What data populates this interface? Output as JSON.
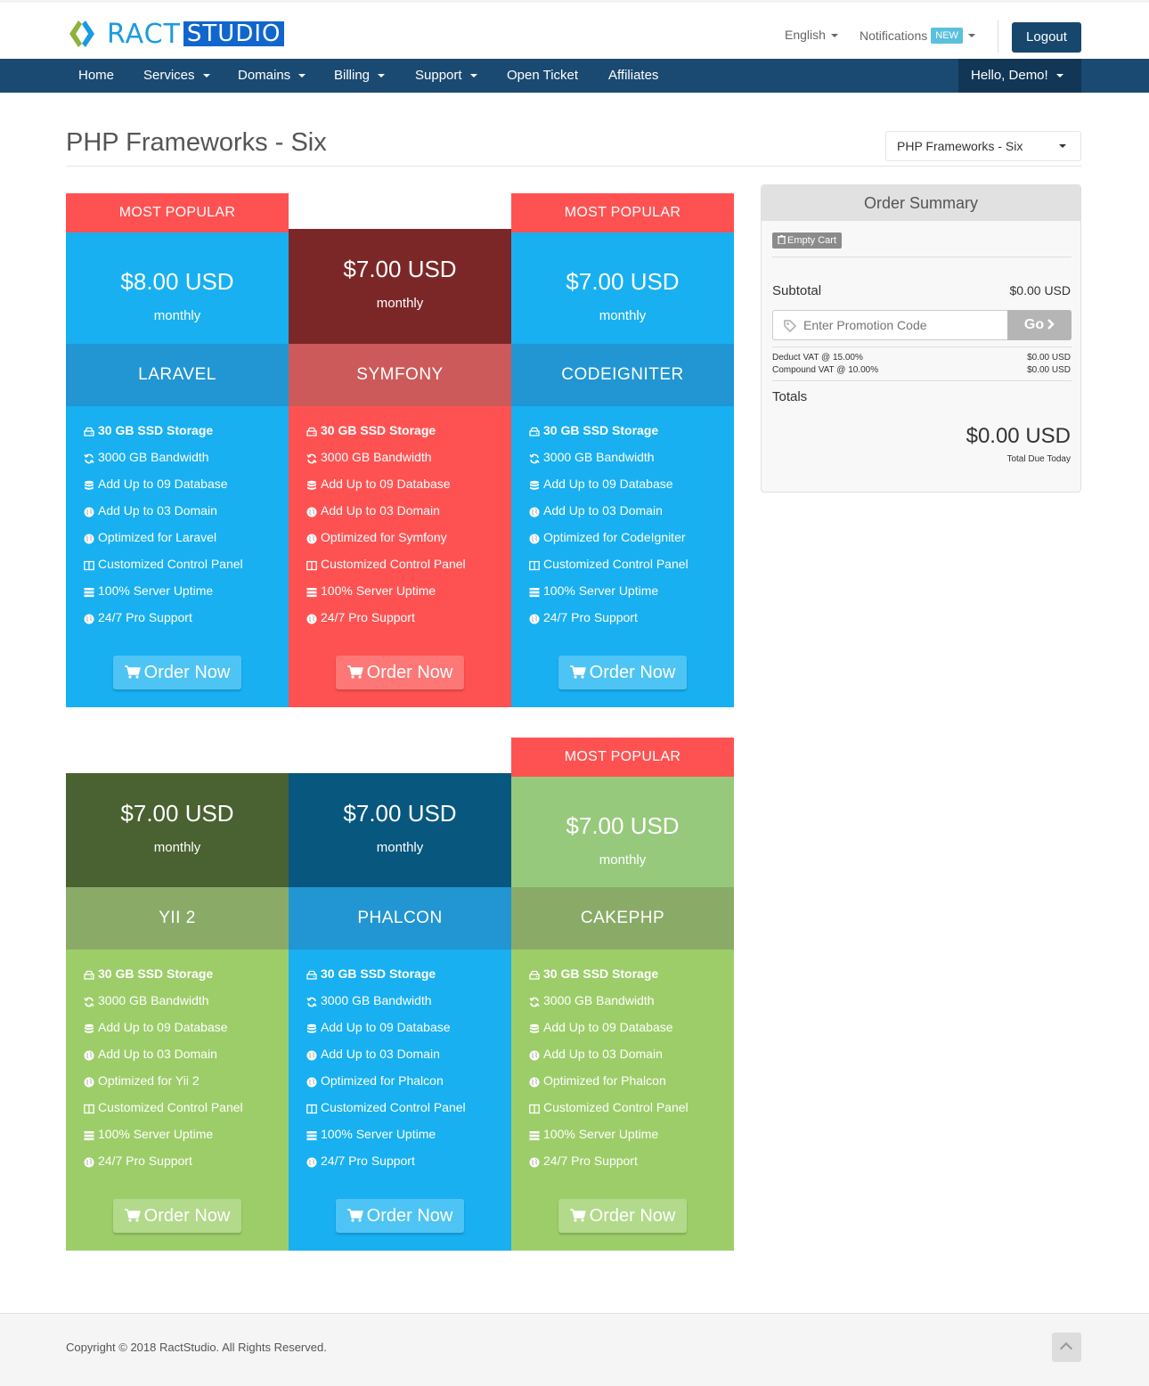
{
  "header": {
    "logo_text1": "RACT",
    "logo_text2": "STUDIO",
    "language": "English",
    "notifications": "Notifications",
    "notifications_badge": "NEW",
    "logout": "Logout"
  },
  "nav": {
    "items": [
      {
        "label": "Home",
        "dropdown": false
      },
      {
        "label": "Services",
        "dropdown": true
      },
      {
        "label": "Domains",
        "dropdown": true
      },
      {
        "label": "Billing",
        "dropdown": true
      },
      {
        "label": "Support",
        "dropdown": true
      },
      {
        "label": "Open Ticket",
        "dropdown": false
      },
      {
        "label": "Affiliates",
        "dropdown": false
      }
    ],
    "user": "Hello, Demo!"
  },
  "page": {
    "title": "PHP Frameworks - Six",
    "category_select": "PHP Frameworks - Six"
  },
  "cards": [
    {
      "name": "LARAVEL",
      "price": "$8.00 USD",
      "cycle": "monthly",
      "popular": "MOST POPULAR",
      "features": [
        "30 GB SSD Storage",
        "3000 GB Bandwidth",
        "Add Up to 09 Database",
        "Add Up to 03 Domain",
        "Optimized for Laravel",
        "Customized Control Panel",
        "100% Server Uptime",
        "24/7 Pro Support"
      ],
      "order": "Order Now"
    },
    {
      "name": "SYMFONY",
      "price": "$7.00 USD",
      "cycle": "monthly",
      "popular": "",
      "features": [
        "30 GB SSD Storage",
        "3000 GB Bandwidth",
        "Add Up to 09 Database",
        "Add Up to 03 Domain",
        "Optimized for Symfony",
        "Customized Control Panel",
        "100% Server Uptime",
        "24/7 Pro Support"
      ],
      "order": "Order Now"
    },
    {
      "name": "CODEIGNITER",
      "price": "$7.00 USD",
      "cycle": "monthly",
      "popular": "MOST POPULAR",
      "features": [
        "30 GB SSD Storage",
        "3000 GB Bandwidth",
        "Add Up to 09 Database",
        "Add Up to 03 Domain",
        "Optimized for CodeIgniter",
        "Customized Control Panel",
        "100% Server Uptime",
        "24/7 Pro Support"
      ],
      "order": "Order Now"
    },
    {
      "name": "YII 2",
      "price": "$7.00 USD",
      "cycle": "monthly",
      "popular": "",
      "features": [
        "30 GB SSD Storage",
        "3000 GB Bandwidth",
        "Add Up to 09 Database",
        "Add Up to 03 Domain",
        "Optimized for Yii 2",
        "Customized Control Panel",
        "100% Server Uptime",
        "24/7 Pro Support"
      ],
      "order": "Order Now"
    },
    {
      "name": "PHALCON",
      "price": "$7.00 USD",
      "cycle": "monthly",
      "popular": "",
      "features": [
        "30 GB SSD Storage",
        "3000 GB Bandwidth",
        "Add Up to 09 Database",
        "Add Up to 03 Domain",
        "Optimized for Phalcon",
        "Customized Control Panel",
        "100% Server Uptime",
        "24/7 Pro Support"
      ],
      "order": "Order Now"
    },
    {
      "name": "CAKEPHP",
      "price": "$7.00 USD",
      "cycle": "monthly",
      "popular": "MOST POPULAR",
      "features": [
        "30 GB SSD Storage",
        "3000 GB Bandwidth",
        "Add Up to 09 Database",
        "Add Up to 03 Domain",
        "Optimized for Phalcon",
        "Customized Control Panel",
        "100% Server Uptime",
        "24/7 Pro Support"
      ],
      "order": "Order Now"
    }
  ],
  "feature_icons": [
    "hdd-icon",
    "refresh-icon",
    "database-icon",
    "globe-icon",
    "globe-icon",
    "columns-icon",
    "server-icon",
    "globe-icon"
  ],
  "summary": {
    "title": "Order Summary",
    "empty_cart": "Empty Cart",
    "subtotal_label": "Subtotal",
    "subtotal_value": "$0.00 USD",
    "promo_placeholder": "Enter Promotion Code",
    "promo_button": "Go",
    "tax1_label": "Deduct VAT @ 15.00%",
    "tax1_value": "$0.00 USD",
    "tax2_label": "Compound VAT @ 10.00%",
    "tax2_value": "$0.00 USD",
    "totals_label": "Totals",
    "total_value": "$0.00 USD",
    "total_due_label": "Total Due Today"
  },
  "footer": {
    "copyright": "Copyright © 2018 RactStudio. All Rights Reserved."
  },
  "colors": {
    "nav_bg": "#1a4a72",
    "popular_red": "#fe5252",
    "blue_price": "#18b0f1",
    "blue_name": "#2196d2",
    "blue_feat": "#18b0f1",
    "maroon_price": "#7c2727",
    "red_name": "#cc5a5a",
    "red_feat": "#fe5252",
    "darkgreen_price": "#4a6131",
    "green_name": "#8aab67",
    "green_feat": "#9dcd69",
    "navy_price": "#07577e",
    "lightgreen_price": "#97c97c"
  }
}
